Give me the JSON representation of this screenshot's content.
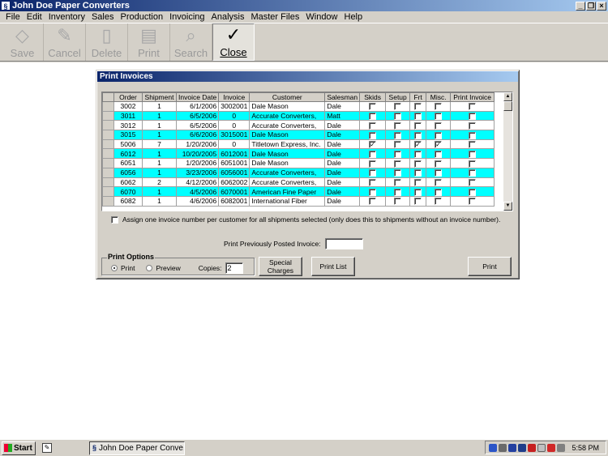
{
  "window": {
    "title": "John Doe Paper Converters",
    "icon": "app-icon"
  },
  "menu": [
    "File",
    "Edit",
    "Inventory",
    "Sales",
    "Production",
    "Invoicing",
    "Analysis",
    "Master Files",
    "Window",
    "Help"
  ],
  "toolbar": [
    {
      "label": "Save",
      "icon": "save-icon"
    },
    {
      "label": "Cancel",
      "icon": "cancel-icon"
    },
    {
      "label": "Delete",
      "icon": "delete-icon"
    },
    {
      "label": "Print",
      "icon": "print-icon"
    },
    {
      "label": "Search",
      "icon": "search-icon"
    },
    {
      "label": "Close",
      "icon": "checkmark-icon"
    }
  ],
  "dialog": {
    "title": "Print Invoices",
    "columns": [
      "Order",
      "Shipment",
      "Invoice Date",
      "Invoice",
      "Customer",
      "Salesman",
      "Skids",
      "Setup",
      "Frt",
      "Misc.",
      "Print Invoice"
    ],
    "rows": [
      {
        "order": "3002",
        "shipment": "1",
        "date": "6/1/2006",
        "invoice": "3002001",
        "customer": "Dale Mason",
        "salesman": "Dale",
        "skids": false,
        "setup": false,
        "frt": false,
        "misc": false,
        "print": false,
        "highlight": false
      },
      {
        "order": "3011",
        "shipment": "1",
        "date": "6/5/2006",
        "invoice": "0",
        "customer": "Accurate Converters,",
        "salesman": "Matt",
        "skids": false,
        "setup": false,
        "frt": false,
        "misc": false,
        "print": false,
        "highlight": true
      },
      {
        "order": "3012",
        "shipment": "1",
        "date": "6/5/2006",
        "invoice": "0",
        "customer": "Accurate Converters,",
        "salesman": "Dale",
        "skids": false,
        "setup": false,
        "frt": false,
        "misc": false,
        "print": false,
        "highlight": false
      },
      {
        "order": "3015",
        "shipment": "1",
        "date": "6/6/2006",
        "invoice": "3015001",
        "customer": "Dale Mason",
        "salesman": "Dale",
        "skids": false,
        "setup": false,
        "frt": false,
        "misc": false,
        "print": false,
        "highlight": true
      },
      {
        "order": "5006",
        "shipment": "7",
        "date": "1/20/2006",
        "invoice": "0",
        "customer": "Titletown Express, Inc.",
        "salesman": "Dale",
        "skids": true,
        "setup": false,
        "frt": true,
        "misc": true,
        "print": false,
        "highlight": false
      },
      {
        "order": "6012",
        "shipment": "1",
        "date": "10/20/2005",
        "invoice": "6012001",
        "customer": "Dale Mason",
        "salesman": "Dale",
        "skids": false,
        "setup": false,
        "frt": false,
        "misc": false,
        "print": false,
        "highlight": true
      },
      {
        "order": "6051",
        "shipment": "1",
        "date": "1/20/2006",
        "invoice": "6051001",
        "customer": "Dale Mason",
        "salesman": "Dale",
        "skids": false,
        "setup": false,
        "frt": false,
        "misc": false,
        "print": false,
        "highlight": false
      },
      {
        "order": "6056",
        "shipment": "1",
        "date": "3/23/2006",
        "invoice": "6056001",
        "customer": "Accurate Converters,",
        "salesman": "Dale",
        "skids": false,
        "setup": false,
        "frt": false,
        "misc": false,
        "print": false,
        "highlight": true
      },
      {
        "order": "6062",
        "shipment": "2",
        "date": "4/12/2006",
        "invoice": "6062002",
        "customer": "Accurate Converters,",
        "salesman": "Dale",
        "skids": false,
        "setup": false,
        "frt": false,
        "misc": false,
        "print": false,
        "highlight": false
      },
      {
        "order": "6070",
        "shipment": "1",
        "date": "4/5/2006",
        "invoice": "6070001",
        "customer": "American Fine Paper",
        "salesman": "Dale",
        "skids": false,
        "setup": false,
        "frt": false,
        "misc": false,
        "print": false,
        "highlight": true
      },
      {
        "order": "6082",
        "shipment": "1",
        "date": "4/6/2006",
        "invoice": "6082001",
        "customer": "International Fiber",
        "salesman": "Dale",
        "skids": false,
        "setup": false,
        "frt": false,
        "misc": false,
        "print": false,
        "highlight": false
      }
    ],
    "assign_label": "Assign one invoice number per customer for all shipments selected (only does this to shipments without an invoice number).",
    "assign_checked": false,
    "print_previously_label": "Print Previously Posted Invoice:",
    "print_previously_value": "",
    "print_options": {
      "legend": "Print Options",
      "print_label": "Print",
      "preview_label": "Preview",
      "selected": "Print",
      "copies_label": "Copies:",
      "copies_value": "2"
    },
    "buttons": {
      "special_charges_line1": "Special",
      "special_charges_line2": "Charges",
      "print_list": "Print List",
      "print": "Print"
    },
    "colors": {
      "highlight": "#00ffff",
      "title_bar": "#0a246a"
    }
  },
  "taskbar": {
    "start_label": "Start",
    "task_label": "John Doe Paper Conve...",
    "clock": "5:58 PM"
  }
}
